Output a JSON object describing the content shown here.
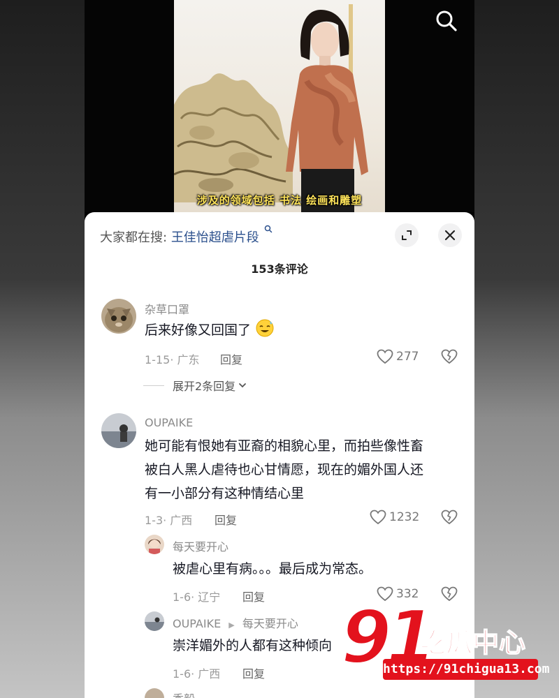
{
  "video": {
    "subtitle": "涉及的领域包括 书法 绘画和雕塑"
  },
  "sheet": {
    "hot_search_prefix": "大家都在搜:",
    "hot_search_term": "王佳怡超虐片段",
    "comment_count_label": "153条评论"
  },
  "comments": [
    {
      "username": "杂草口罩",
      "text": "后来好像又回国了",
      "emoji": "sweat-smile-emoji",
      "meta": "1-15· 广东",
      "reply_label": "回复",
      "likes": "277",
      "expand_label": "展开2条回复"
    },
    {
      "username": "OUPAIKE",
      "text_lines": [
        "她可能有恨她有亚裔的相貌心里，而拍些像性畜",
        "被白人黑人虐待也心甘情愿，现在的媚外国人还",
        "有一小部分有这种情结心里"
      ],
      "meta": "1-3· 广西",
      "reply_label": "回复",
      "likes": "1232",
      "replies": [
        {
          "username": "每天要开心",
          "text": "被虐心里有病。。。最后成为常态。",
          "meta": "1-6· 辽宁",
          "reply_label": "回复",
          "likes": "332"
        },
        {
          "username": "OUPAIKE",
          "reply_to": "每天要开心",
          "text": "崇洋媚外的人都有这种倾向",
          "meta": "1-6· 广西",
          "reply_label": "回复"
        },
        {
          "username": "秀毅"
        }
      ]
    }
  ],
  "watermark": {
    "number": "91",
    "name": "吃瓜中心",
    "url": "https://91chigua13.com"
  },
  "colors": {
    "subtitle": "#ffe45a",
    "hot_search_term": "#2a4f8c",
    "watermark_red": "#e3121d"
  }
}
